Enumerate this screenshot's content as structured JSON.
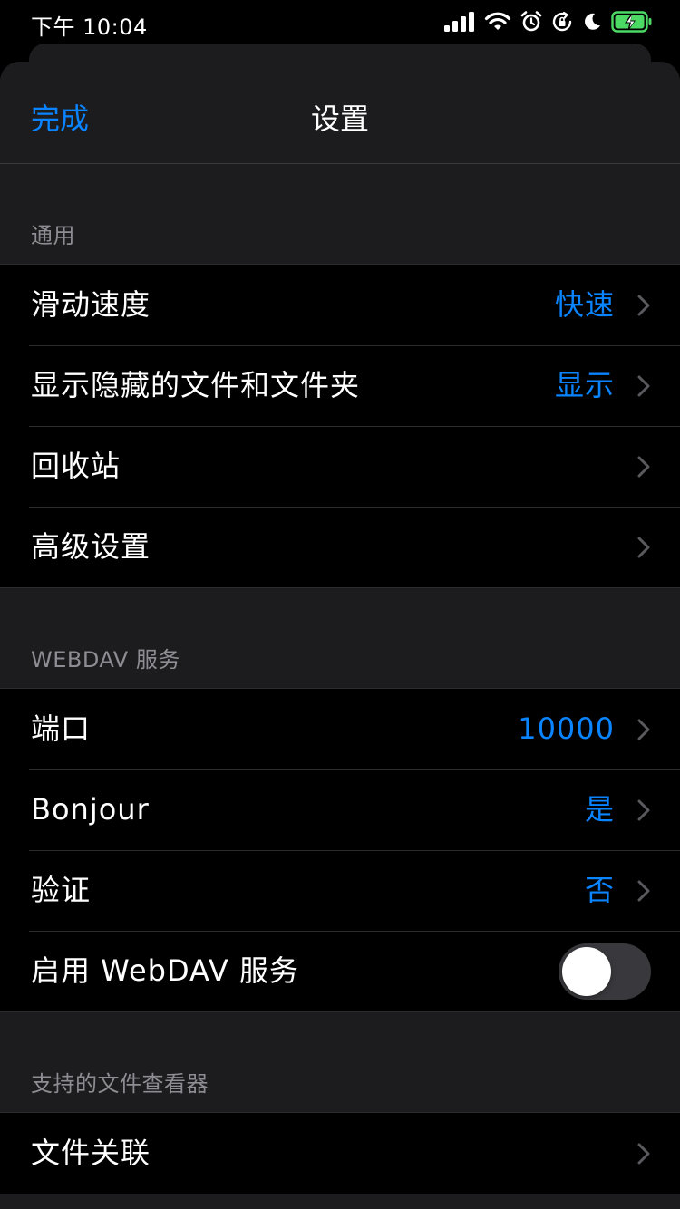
{
  "status_bar": {
    "time": "下午 10:04"
  },
  "nav": {
    "done_label": "完成",
    "title": "设置"
  },
  "sections": {
    "general": {
      "header": "通用",
      "rows": [
        {
          "label": "滑动速度",
          "value": "快速"
        },
        {
          "label": "显示隐藏的文件和文件夹",
          "value": "显示"
        },
        {
          "label": "回收站",
          "value": ""
        },
        {
          "label": "高级设置",
          "value": ""
        }
      ]
    },
    "webdav": {
      "header": "WEBDAV 服务",
      "rows": [
        {
          "label": "端口",
          "value": "10000"
        },
        {
          "label": "Bonjour",
          "value": "是"
        },
        {
          "label": "验证",
          "value": "否"
        }
      ],
      "toggle": {
        "label": "启用 WebDAV 服务",
        "on": false
      }
    },
    "viewers": {
      "header": "支持的文件查看器",
      "rows": [
        {
          "label": "文件关联",
          "value": ""
        }
      ]
    }
  },
  "colors": {
    "accent": "#0a84ff",
    "battery_charge": "#4cd964"
  },
  "icons": [
    "cellular-signal-icon",
    "wifi-icon",
    "alarm-icon",
    "orientation-lock-icon",
    "moon-icon",
    "battery-charging-icon",
    "chevron-right-icon"
  ]
}
